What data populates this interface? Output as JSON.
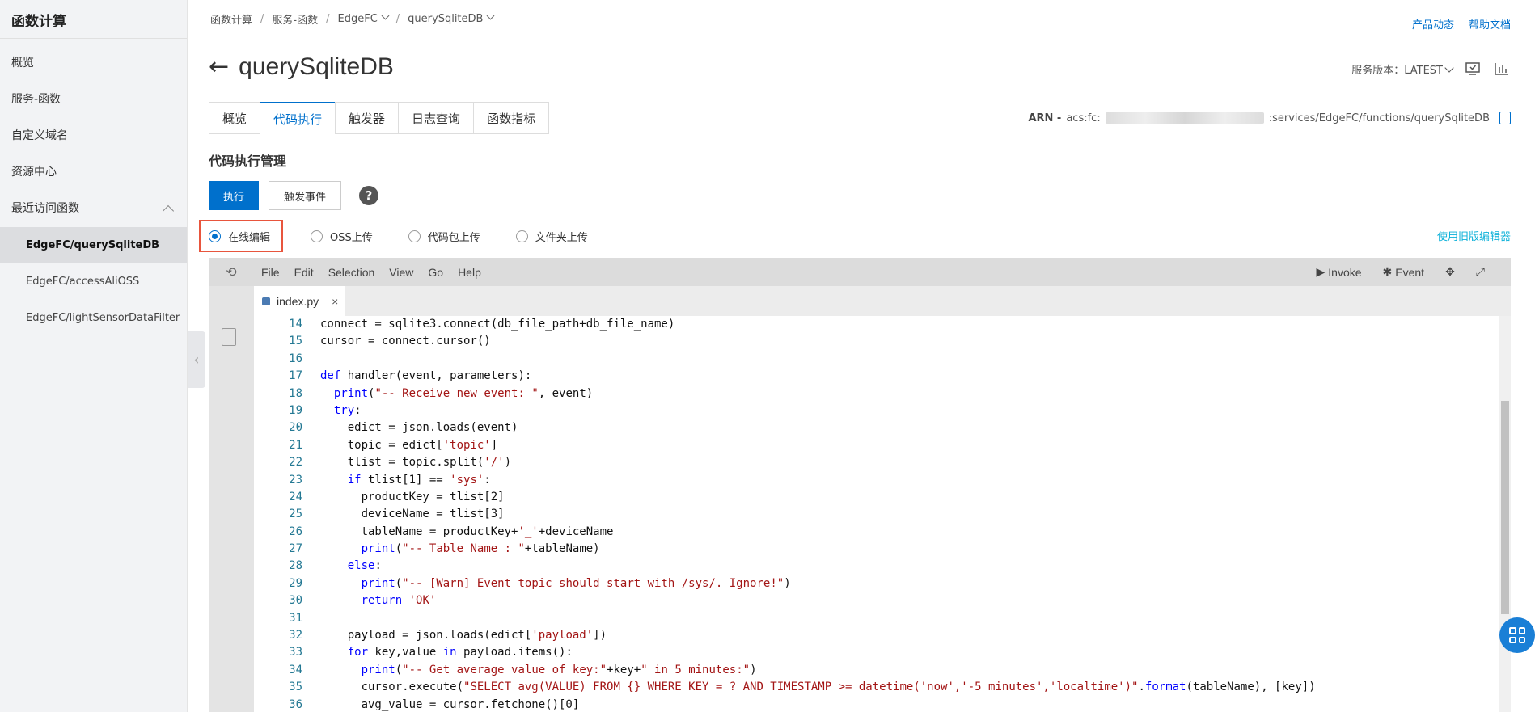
{
  "sidebar": {
    "brand": "函数计算",
    "items": [
      {
        "label": "概览"
      },
      {
        "label": "服务-函数"
      },
      {
        "label": "自定义域名"
      },
      {
        "label": "资源中心"
      }
    ],
    "recent_group": "最近访问函数",
    "recent": [
      {
        "label": "EdgeFC/querySqliteDB",
        "active": true
      },
      {
        "label": "EdgeFC/accessAliOSS"
      },
      {
        "label": "EdgeFC/lightSensorDataFilter"
      }
    ]
  },
  "breadcrumb": [
    "函数计算",
    "服务-函数",
    "EdgeFC",
    "querySqliteDB"
  ],
  "top_links": {
    "news": "产品动态",
    "help": "帮助文档"
  },
  "page_title": "querySqliteDB",
  "version": {
    "label": "服务版本：LATEST"
  },
  "tabs": [
    "概览",
    "代码执行",
    "触发器",
    "日志查询",
    "函数指标"
  ],
  "active_tab": 1,
  "arn": {
    "prefix": "ARN -",
    "start": "acs:fc:",
    "suffix": ":services/EdgeFC/functions/querySqliteDB"
  },
  "section_title": "代码执行管理",
  "buttons": {
    "execute": "执行",
    "trigger_event": "触发事件",
    "help": "?"
  },
  "radios": [
    "在线编辑",
    "OSS上传",
    "代码包上传",
    "文件夹上传"
  ],
  "selected_radio": 0,
  "legacy_editor_link": "使用旧版编辑器",
  "editor": {
    "menus": [
      "File",
      "Edit",
      "Selection",
      "View",
      "Go",
      "Help"
    ],
    "invoke": "Invoke",
    "event": "Event",
    "file_tab": "index.py",
    "close": "×",
    "code_lines": [
      {
        "n": "14",
        "t": "connect = sqlite3.connect(db_file_path+db_file_name)"
      },
      {
        "n": "15",
        "t": "cursor = connect.cursor()"
      },
      {
        "n": "16",
        "t": ""
      },
      {
        "n": "17",
        "t": "def handler(event, parameters):"
      },
      {
        "n": "18",
        "t": "  print(\"-- Receive new event: \", event)"
      },
      {
        "n": "19",
        "t": "  try:"
      },
      {
        "n": "20",
        "t": "    edict = json.loads(event)"
      },
      {
        "n": "21",
        "t": "    topic = edict['topic']"
      },
      {
        "n": "22",
        "t": "    tlist = topic.split('/')"
      },
      {
        "n": "23",
        "t": "    if tlist[1] == 'sys':"
      },
      {
        "n": "24",
        "t": "      productKey = tlist[2]"
      },
      {
        "n": "25",
        "t": "      deviceName = tlist[3]"
      },
      {
        "n": "26",
        "t": "      tableName = productKey+'_'+deviceName"
      },
      {
        "n": "27",
        "t": "      print(\"-- Table Name : \"+tableName)"
      },
      {
        "n": "28",
        "t": "    else:"
      },
      {
        "n": "29",
        "t": "      print(\"-- [Warn] Event topic should start with /sys/. Ignore!\")"
      },
      {
        "n": "30",
        "t": "      return 'OK'"
      },
      {
        "n": "31",
        "t": ""
      },
      {
        "n": "32",
        "t": "    payload = json.loads(edict['payload'])"
      },
      {
        "n": "33",
        "t": "    for key,value in payload.items():"
      },
      {
        "n": "34",
        "t": "      print(\"-- Get average value of key:\"+key+\" in 5 minutes:\")"
      },
      {
        "n": "35",
        "t": "      cursor.execute(\"SELECT avg(VALUE) FROM {} WHERE KEY = ? AND TIMESTAMP >= datetime('now','-5 minutes','localtime')\".format(tableName), [key])"
      },
      {
        "n": "36",
        "t": "      avg_value = cursor.fetchone()[0]"
      }
    ]
  },
  "colors": {
    "accent": "#0070cc",
    "highlight_border": "#e8553d",
    "link_cyan": "#0ab0d8"
  }
}
